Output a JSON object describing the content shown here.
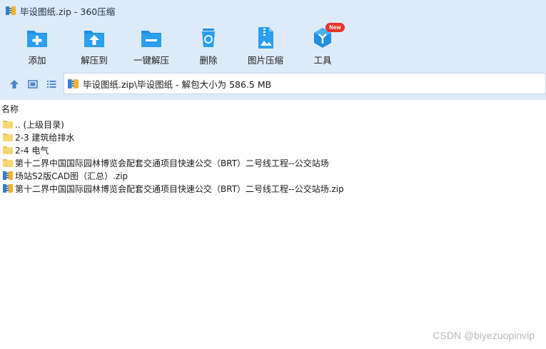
{
  "window": {
    "title": "毕设图纸.zip - 360压缩"
  },
  "toolbar": {
    "items": [
      {
        "label": "添加",
        "icon": "add-file-icon"
      },
      {
        "label": "解压到",
        "icon": "extract-to-icon"
      },
      {
        "label": "一键解压",
        "icon": "one-click-extract-icon"
      },
      {
        "label": "删除",
        "icon": "delete-recycle-icon"
      },
      {
        "label": "图片压缩",
        "icon": "image-compress-icon"
      },
      {
        "label": "工具",
        "icon": "tools-cube-icon",
        "badge": "New"
      }
    ]
  },
  "address": {
    "path": "毕设图纸.zip\\毕设图纸 - 解包大小为 586.5 MB"
  },
  "list": {
    "header": "名称",
    "rows": [
      {
        "name": ".. (上级目录)",
        "type": "folder"
      },
      {
        "name": "2-3 建筑给排水",
        "type": "folder"
      },
      {
        "name": "2-4 电气",
        "type": "folder"
      },
      {
        "name": "第十二界中国国际园林博览会配套交通项目快速公交（BRT）二号线工程--公交站场",
        "type": "folder"
      },
      {
        "name": "场站S2版CAD图（汇总）.zip",
        "type": "zip"
      },
      {
        "name": "第十二界中国国际园林博览会配套交通项目快速公交（BRT）二号线工程--公交站场.zip",
        "type": "zip"
      }
    ]
  },
  "watermark": "CSDN @biyezuopinvip",
  "colors": {
    "chrome_bg": "#ddeaf8",
    "icon_blue": "#1f8fe0",
    "folder_yellow": "#f7d774",
    "badge_red": "#e8322a"
  }
}
